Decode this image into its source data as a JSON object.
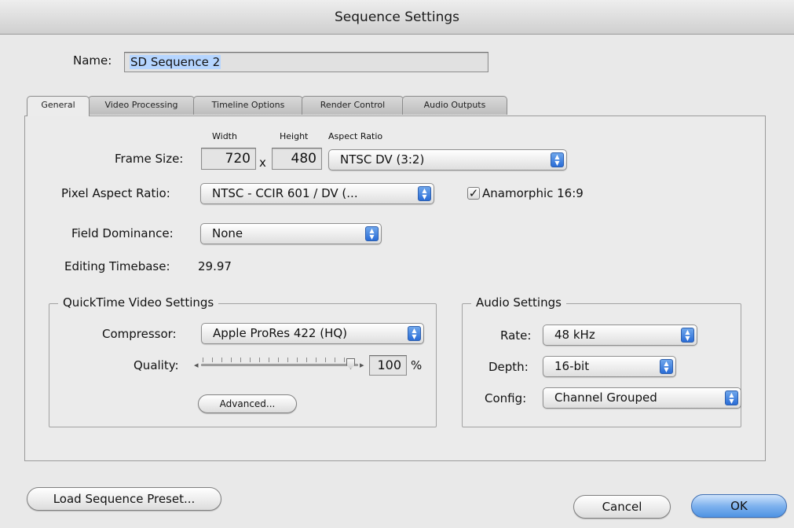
{
  "window": {
    "title": "Sequence Settings"
  },
  "name": {
    "label": "Name:",
    "value": "SD Sequence 2"
  },
  "tabs": [
    "General",
    "Video Processing",
    "Timeline Options",
    "Render Control",
    "Audio Outputs"
  ],
  "general": {
    "frame_size": {
      "label": "Frame Size:",
      "width_header": "Width",
      "height_header": "Height",
      "aspect_header": "Aspect Ratio",
      "width": "720",
      "x": "x",
      "height": "480",
      "aspect_ratio": "NTSC DV (3:2)"
    },
    "pixel_aspect": {
      "label": "Pixel Aspect Ratio:",
      "value": "NTSC - CCIR 601 / DV (..."
    },
    "anamorphic": {
      "label": "Anamorphic 16:9",
      "checked": true
    },
    "field_dominance": {
      "label": "Field Dominance:",
      "value": "None"
    },
    "editing_timebase": {
      "label": "Editing Timebase:",
      "value": "29.97"
    },
    "quicktime": {
      "title": "QuickTime Video Settings",
      "compressor_label": "Compressor:",
      "compressor": "Apple ProRes 422 (HQ)",
      "quality_label": "Quality:",
      "quality": "100",
      "quality_fraction": 1.0,
      "percent": "%",
      "advanced": "Advanced..."
    },
    "audio": {
      "title": "Audio Settings",
      "rate_label": "Rate:",
      "rate": "48 kHz",
      "depth_label": "Depth:",
      "depth": "16-bit",
      "config_label": "Config:",
      "config": "Channel Grouped"
    }
  },
  "footer": {
    "load_preset": "Load Sequence Preset...",
    "cancel": "Cancel",
    "ok": "OK"
  },
  "colors": {
    "accent": "#2a6cd6",
    "selection": "#b5d5ff"
  }
}
